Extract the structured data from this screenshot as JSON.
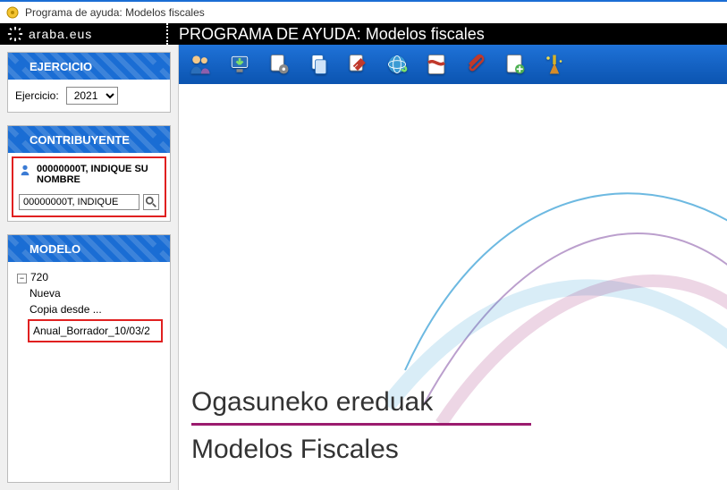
{
  "window": {
    "title": "Programa de ayuda: Modelos fiscales"
  },
  "brand": {
    "text": "araba.eus"
  },
  "header": {
    "title": "PROGRAMA DE AYUDA: Modelos fiscales"
  },
  "sidebar": {
    "ejercicio": {
      "header": "EJERCICIO",
      "label": "Ejercicio:",
      "selected": "2021"
    },
    "contribuyente": {
      "header": "CONTRIBUYENTE",
      "name": "00000000T, INDIQUE SU NOMBRE",
      "search_value": "00000000T, INDIQUE"
    },
    "modelo": {
      "header": "MODELO",
      "root": "720",
      "items": [
        "Nueva",
        "Copia desde ...",
        "Anual_Borrador_10/03/2"
      ]
    }
  },
  "toolbar": {
    "icons": [
      "users-icon",
      "download-icon",
      "settings-icon",
      "copy-icon",
      "tools-icon",
      "globe-icon",
      "pdf-icon",
      "attach-icon",
      "new-page-icon",
      "clean-icon"
    ]
  },
  "main": {
    "title_eu": "Ogasuneko ereduak",
    "title_es": "Modelos Fiscales"
  },
  "colors": {
    "accent": "#1a6dd4",
    "highlight": "#e02020",
    "underline": "#9b1b6e"
  }
}
